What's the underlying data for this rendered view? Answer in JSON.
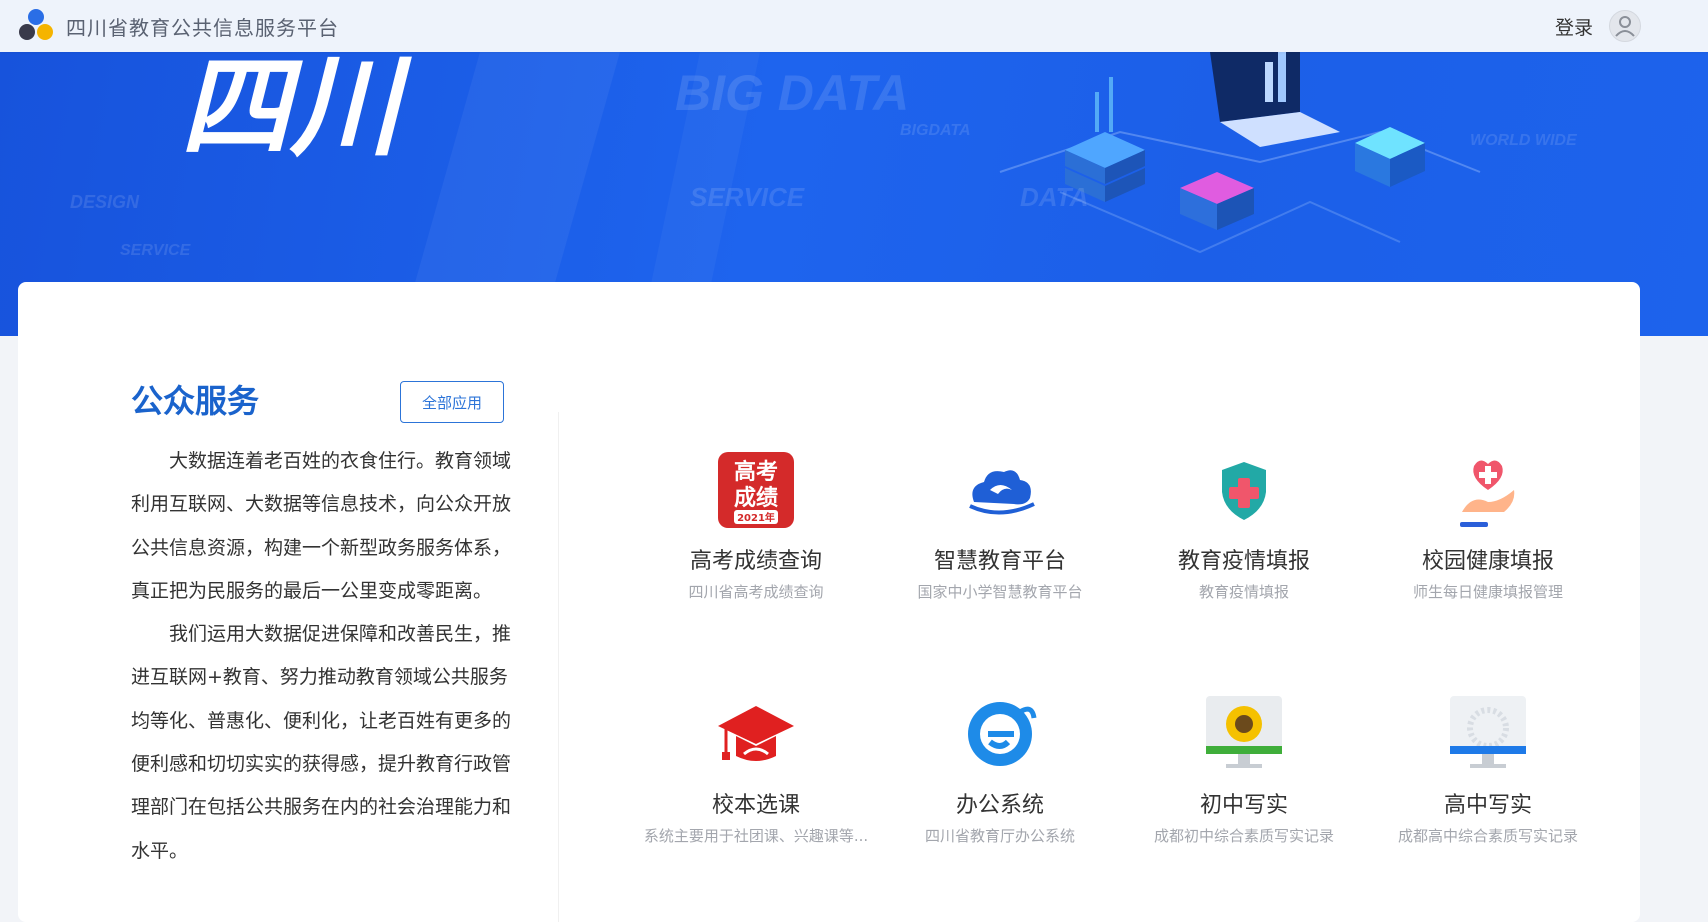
{
  "header": {
    "site_title": "四川省教育公共信息服务平台",
    "login_label": "登录",
    "logo_icon": "three-dots-logo-icon",
    "avatar_icon": "user-avatar-icon"
  },
  "banner": {
    "bg_texts": [
      "BIG DATA",
      "SERVICE",
      "DESIGN",
      "DATA",
      "WORLD WIDE",
      "BIGDATA",
      "SERVICE"
    ],
    "hero_text": "四川"
  },
  "public_services": {
    "title": "公众服务",
    "all_apps_label": "全部应用",
    "paragraphs": [
      "大数据连着老百姓的衣食住行。教育领域利用互联网、大数据等信息技术，向公众开放公共信息资源，构建一个新型政务服务体系，真正把为民服务的最后一公里变成零距离。",
      "我们运用大数据促进保障和改善民生，推进互联网+教育、努力推动教育领域公共服务均等化、普惠化、便利化，让老百姓有更多的便利感和切切实实的获得感，提升教育行政管理部门在包括公共服务在内的社会治理能力和水平。"
    ]
  },
  "apps": [
    {
      "name": "高考成绩查询",
      "subtitle": "四川省高考成绩查询",
      "icon": "gaokao-score-icon",
      "icon_text_1": "高考",
      "icon_text_2": "成绩",
      "icon_badge": "2021年"
    },
    {
      "name": "智慧教育平台",
      "subtitle": "国家中小学智慧教育平台",
      "icon": "cloud-education-icon"
    },
    {
      "name": "教育疫情填报",
      "subtitle": "教育疫情填报",
      "icon": "medical-shield-icon"
    },
    {
      "name": "校园健康填报",
      "subtitle": "师生每日健康填报管理",
      "icon": "heart-hand-icon"
    },
    {
      "name": "校本选课",
      "subtitle": "系统主要用于社团课、兴趣课等...",
      "icon": "graduation-cap-icon"
    },
    {
      "name": "办公系统",
      "subtitle": "四川省教育厅办公系统",
      "icon": "edge-browser-icon"
    },
    {
      "name": "初中写实",
      "subtitle": "成都初中综合素质写实记录",
      "icon": "sunflower-monitor-icon"
    },
    {
      "name": "高中写实",
      "subtitle": "成都高中综合素质写实记录",
      "icon": "dandelion-monitor-icon"
    }
  ],
  "colors": {
    "brand_blue": "#1a63cc",
    "banner_blue": "#1e64ee",
    "gaokao_red": "#d42a2a",
    "shield_teal": "#22a9a6",
    "heart_pink": "#f0566b"
  }
}
